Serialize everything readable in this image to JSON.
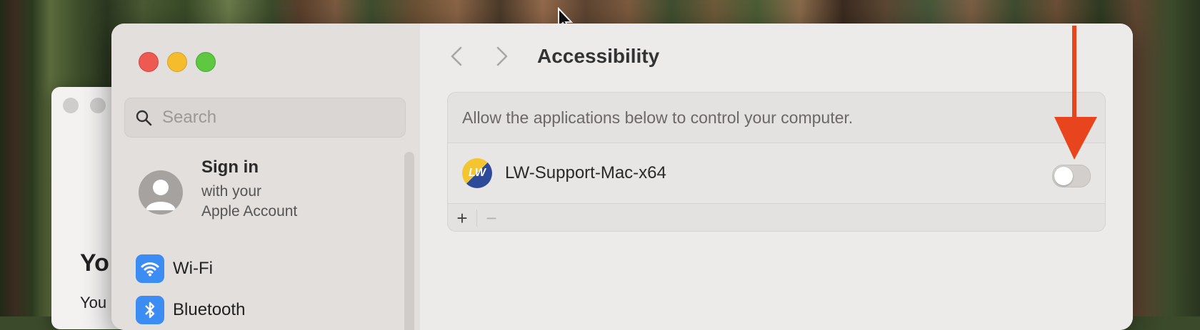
{
  "sidebar": {
    "search_placeholder": "Search",
    "account": {
      "title": "Sign in",
      "subtitle_line1": "with your",
      "subtitle_line2": "Apple Account"
    },
    "items": [
      {
        "label": "Wi-Fi",
        "icon": "wifi-icon"
      },
      {
        "label": "Bluetooth",
        "icon": "bluetooth-icon"
      }
    ]
  },
  "background_window": {
    "heading_fragment": "Yo",
    "text_fragment": "You"
  },
  "content": {
    "title": "Accessibility",
    "description": "Allow the applications below to control your computer.",
    "apps": [
      {
        "name": "LW-Support-Mac-x64",
        "logo_text": "LW",
        "enabled": false
      }
    ],
    "add_label": "+",
    "remove_label": "−"
  },
  "annotation": {
    "arrow_color": "#e8451f"
  }
}
